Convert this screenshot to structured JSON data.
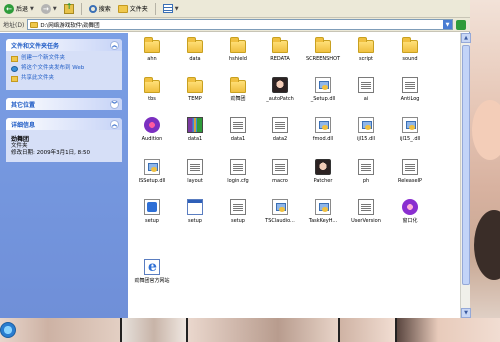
{
  "toolbar": {
    "back_label": "后退",
    "search_label": "搜索",
    "folders_label": "文件夹"
  },
  "address": {
    "label": "地址(D)",
    "path": "D:\\网络游戏软件\\劲舞团"
  },
  "tasks_panel": {
    "title": "文件和文件夹任务",
    "items": [
      "创建一个新文件夹",
      "将这个文件夹发布到 Web",
      "共享此文件夹"
    ]
  },
  "places_panel": {
    "title": "其它位置"
  },
  "details_panel": {
    "title": "详细信息",
    "name": "劲舞团",
    "type": "文件夹",
    "modified": "修改日期: 2009年3月1日, 8:50"
  },
  "files": [
    {
      "name": "ahn",
      "type": "folder"
    },
    {
      "name": "data",
      "type": "folder"
    },
    {
      "name": "hshield",
      "type": "folder"
    },
    {
      "name": "REDATA",
      "type": "folder"
    },
    {
      "name": "SCREENSHOT",
      "type": "folder"
    },
    {
      "name": "script",
      "type": "folder"
    },
    {
      "name": "sound",
      "type": "folder"
    },
    {
      "name": "tbs",
      "type": "folder"
    },
    {
      "name": "TEMP",
      "type": "folder"
    },
    {
      "name": "劲舞团",
      "type": "folder"
    },
    {
      "name": "_autoPatch",
      "type": "face"
    },
    {
      "name": "_Setup.dll",
      "type": "dll"
    },
    {
      "name": "ai",
      "type": "doc"
    },
    {
      "name": "AntiLog",
      "type": "doc"
    },
    {
      "name": "Audition",
      "type": "audition"
    },
    {
      "name": "data1",
      "type": "zip"
    },
    {
      "name": "data1",
      "type": "doc"
    },
    {
      "name": "data2",
      "type": "doc"
    },
    {
      "name": "fmod.dll",
      "type": "dll"
    },
    {
      "name": "ijl15.dll",
      "type": "dll"
    },
    {
      "name": "ijl15_.dll",
      "type": "dll"
    },
    {
      "name": "ISSetup.dll",
      "type": "dll"
    },
    {
      "name": "layout",
      "type": "doc"
    },
    {
      "name": "login.cfg",
      "type": "doc"
    },
    {
      "name": "macro",
      "type": "doc"
    },
    {
      "name": "Patcher",
      "type": "face"
    },
    {
      "name": "ph",
      "type": "doc"
    },
    {
      "name": "ReleaseIP",
      "type": "doc"
    },
    {
      "name": "setup",
      "type": "setup"
    },
    {
      "name": "setup",
      "type": "exe"
    },
    {
      "name": "setup",
      "type": "doc"
    },
    {
      "name": "TSClaudio...",
      "type": "dll"
    },
    {
      "name": "TaskKeyH...",
      "type": "dll"
    },
    {
      "name": "UserVersion",
      "type": "doc"
    },
    {
      "name": "窗口化",
      "type": "pink"
    },
    {
      "name": "劲舞团官方网站",
      "type": "web"
    }
  ]
}
